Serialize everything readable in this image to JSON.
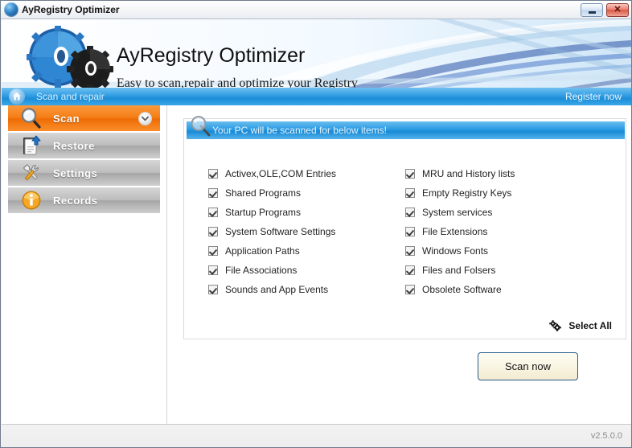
{
  "window": {
    "title": "AyRegistry Optimizer",
    "icon": "app-globe-icon",
    "minimize_label": "",
    "close_label": "✕"
  },
  "banner": {
    "title": "AyRegistry Optimizer",
    "subtitle": "Easy to scan,repair and optimize your Registry",
    "logo_icon": "gears-icon"
  },
  "navbar": {
    "home_icon": "home-icon",
    "breadcrumb": "Scan and repair",
    "register_link": "Register now"
  },
  "sidebar": {
    "items": [
      {
        "label": "Scan",
        "icon": "magnifier-icon",
        "state": "active",
        "chevron": "chevron-down-icon"
      },
      {
        "label": "Restore",
        "icon": "restore-icon",
        "state": "idle"
      },
      {
        "label": "Settings",
        "icon": "tools-icon",
        "state": "idle"
      },
      {
        "label": "Records",
        "icon": "info-icon",
        "state": "idle"
      }
    ]
  },
  "panel": {
    "header": "Your PC will be scanned for below items!",
    "header_icon": "magnifier-icon",
    "left_column": [
      "Activex,OLE,COM Entries",
      "Shared Programs",
      "Startup Programs",
      "System Software Settings",
      "Application Paths",
      "File Associations",
      "Sounds and App Events"
    ],
    "right_column": [
      "MRU and History lists",
      "Empty Registry Keys",
      "System services",
      "File Extensions",
      "Windows Fonts",
      "Files and Folsers",
      "Obsolete Software"
    ],
    "all_checked": true,
    "select_all_label": "Select All",
    "select_all_icon": "gears-small-icon"
  },
  "actions": {
    "scan_now_label": "Scan now"
  },
  "statusbar": {
    "version": "v2.5.0.0"
  },
  "colors": {
    "accent_orange": "#ee6c05",
    "accent_blue": "#1a8bd6",
    "nav_blue": "#1b8ed8",
    "sidebar_idle_gray": "#a6a6a6",
    "button_border": "#2b5b8c"
  }
}
